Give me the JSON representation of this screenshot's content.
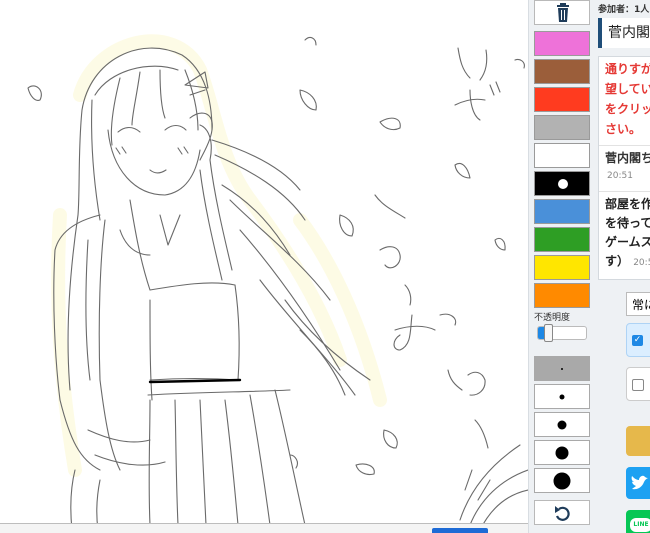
{
  "tools": {
    "delete_icon": "trash-icon",
    "colors": [
      "#ee72d9",
      "#9b5e3a",
      "#ff3b1f",
      "#b2b2b2",
      "#ffffff",
      "#000000",
      "#4a90d9",
      "#2e9e24",
      "#ffe600",
      "#ff8a00"
    ],
    "selected_color": "#000000",
    "opacity_label": "不透明度",
    "opacity_value": 0.2,
    "brush_sizes": [
      2,
      5,
      9,
      13,
      17
    ],
    "active_brush_size": 2,
    "undo_icon": "undo-icon"
  },
  "chat": {
    "participants": "参加者：1人",
    "room_title": "菅内閣",
    "system_message": [
      "通りすが",
      "望してい",
      "をクリッ",
      "さい。"
    ],
    "messages": [
      {
        "name": "菅内閣ち",
        "time": "20:51"
      },
      {
        "body": [
          "部屋を作",
          "を待って",
          "ゲームス",
          "す）"
        ],
        "time": "20:5"
      }
    ],
    "select_value": "常に",
    "twitter_icon": "twitter-bird-icon",
    "line_label": "LINE"
  }
}
